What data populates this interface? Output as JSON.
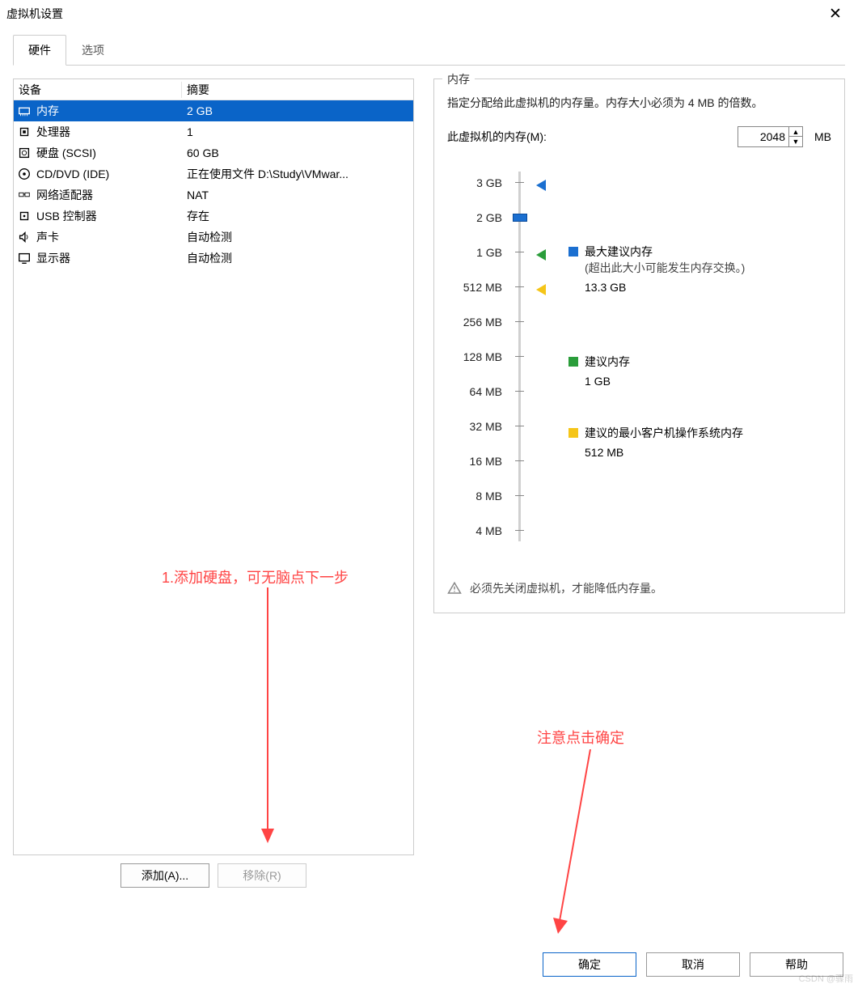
{
  "window": {
    "title": "虚拟机设置"
  },
  "tabs": {
    "hardware": "硬件",
    "options": "选项"
  },
  "headers": {
    "device": "设备",
    "summary": "摘要"
  },
  "devices": [
    {
      "name": "内存",
      "summary": "2 GB",
      "icon": "memory"
    },
    {
      "name": "处理器",
      "summary": "1",
      "icon": "cpu"
    },
    {
      "name": "硬盘 (SCSI)",
      "summary": "60 GB",
      "icon": "disk"
    },
    {
      "name": "CD/DVD (IDE)",
      "summary": "正在使用文件 D:\\Study\\VMwar...",
      "icon": "cd"
    },
    {
      "name": "网络适配器",
      "summary": "NAT",
      "icon": "net"
    },
    {
      "name": "USB 控制器",
      "summary": "存在",
      "icon": "usb"
    },
    {
      "name": "声卡",
      "summary": "自动检测",
      "icon": "sound"
    },
    {
      "name": "显示器",
      "summary": "自动检测",
      "icon": "display"
    }
  ],
  "buttons": {
    "add": "添加(A)...",
    "remove": "移除(R)",
    "ok": "确定",
    "cancel": "取消",
    "help": "帮助"
  },
  "mem": {
    "legend": "内存",
    "desc": "指定分配给此虚拟机的内存量。内存大小必须为 4 MB 的倍数。",
    "label": "此虚拟机的内存(M):",
    "value": "2048",
    "unit": "MB",
    "ticks": [
      "3 GB",
      "2 GB",
      "1 GB",
      "512 MB",
      "256 MB",
      "128 MB",
      "64 MB",
      "32 MB",
      "16 MB",
      "8 MB",
      "4 MB"
    ],
    "legend_max": "最大建议内存",
    "legend_max_sub": "(超出此大小可能发生内存交换。)",
    "legend_max_val": "13.3 GB",
    "legend_rec": "建议内存",
    "legend_rec_val": "1 GB",
    "legend_min": "建议的最小客户机操作系统内存",
    "legend_min_val": "512 MB",
    "warn": "必须先关闭虚拟机，才能降低内存量。"
  },
  "annotations": {
    "a1": "1.添加硬盘，可无脑点下一步",
    "a2": "注意点击确定"
  },
  "watermark": "CSDN @骤雨"
}
